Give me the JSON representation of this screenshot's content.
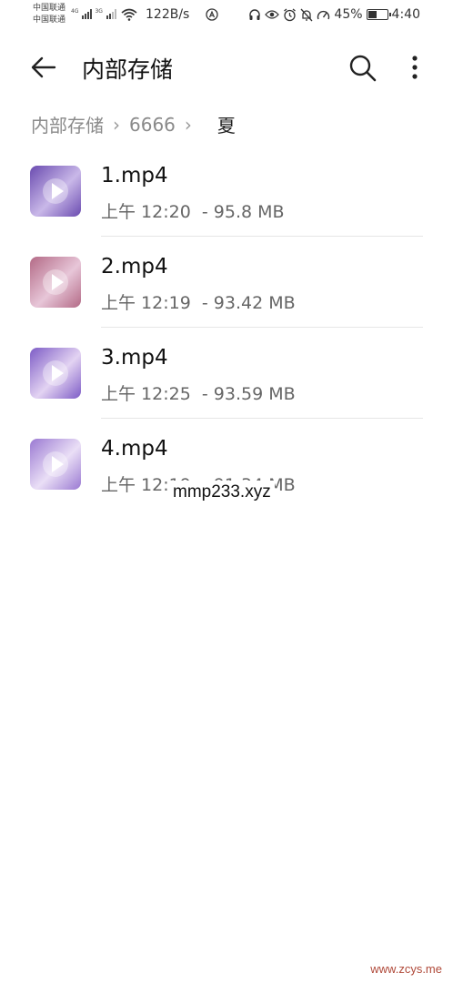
{
  "status_bar": {
    "carrier_1": "中国联通",
    "carrier_2": "中国联通",
    "net_1": "4G",
    "net_2": "3G",
    "speed": "122B/s",
    "battery": "45%",
    "battery_level": 0.45,
    "time": "4:40",
    "icons": [
      "signal-icon",
      "wifi-icon",
      "nfc-icon",
      "headset-icon",
      "eye-icon",
      "alarm-icon",
      "mute-icon",
      "speed-icon",
      "battery-icon"
    ]
  },
  "app_bar": {
    "title": "内部存储",
    "icons": [
      "back-arrow-icon",
      "search-icon",
      "more-vertical-icon"
    ]
  },
  "breadcrumb": {
    "items": [
      "内部存储",
      "6666",
      "夏"
    ]
  },
  "files": [
    {
      "name": "1.mp4",
      "meta": "上午 12:20  - 95.8 MB",
      "thumb_colors": [
        "#6a4bb0",
        "#c9b8e8"
      ]
    },
    {
      "name": "2.mp4",
      "meta": "上午 12:19  - 93.42 MB",
      "thumb_colors": [
        "#b36a86",
        "#e7c6d8"
      ]
    },
    {
      "name": "3.mp4",
      "meta": "上午 12:25  - 93.59 MB",
      "thumb_colors": [
        "#7d5cc6",
        "#e3d3f2"
      ]
    },
    {
      "name": "4.mp4",
      "meta": "上午 12:19  - 91.34 MB",
      "thumb_colors": [
        "#9a79d2",
        "#eadff6"
      ]
    }
  ],
  "watermarks": {
    "center": "mmp233.xyz",
    "corner": "www.zcys.me"
  }
}
